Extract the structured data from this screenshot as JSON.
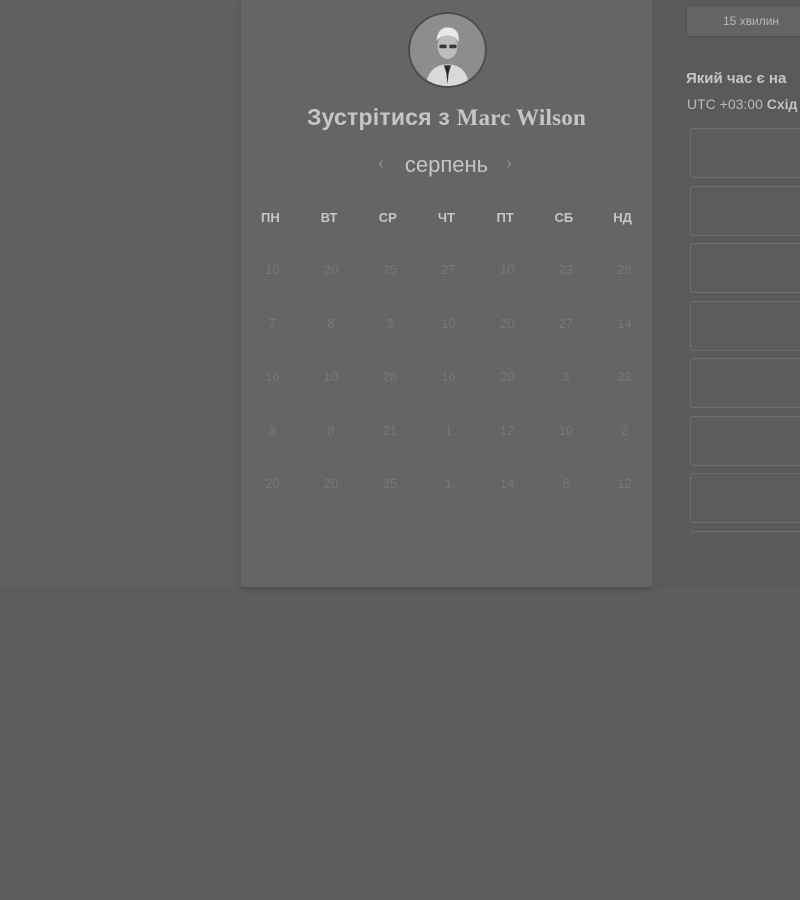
{
  "calendar": {
    "title_prefix": "Зустрітися з",
    "host_name": "Marc Wilson",
    "month": "серпень",
    "prev_icon": "chevron-left-icon",
    "next_icon": "chevron-right-icon",
    "weekdays": [
      "ПН",
      "ВТ",
      "СР",
      "ЧТ",
      "ПТ",
      "СБ",
      "НД"
    ],
    "weeks": [
      [
        "10",
        "20",
        "25",
        "27",
        "10",
        "23",
        "28"
      ],
      [
        "7",
        "8",
        "3",
        "10",
        "20",
        "27",
        "14"
      ],
      [
        "16",
        "10",
        "28",
        "16",
        "20",
        "3",
        "22"
      ],
      [
        "3",
        "8",
        "21",
        "1",
        "12",
        "10",
        "2"
      ],
      [
        "20",
        "20",
        "25",
        "1",
        "14",
        "6",
        "12"
      ]
    ]
  },
  "sidebar": {
    "duration_label": "15 хвилин",
    "timezone_question": "Який час є на",
    "timezone_prefix": "UTC +03:00",
    "timezone_region": "Схід",
    "slot_count": 8
  },
  "colors": {
    "overlay": "#5d5d5d",
    "card": "#656565",
    "panel": "#5a5a5a"
  }
}
